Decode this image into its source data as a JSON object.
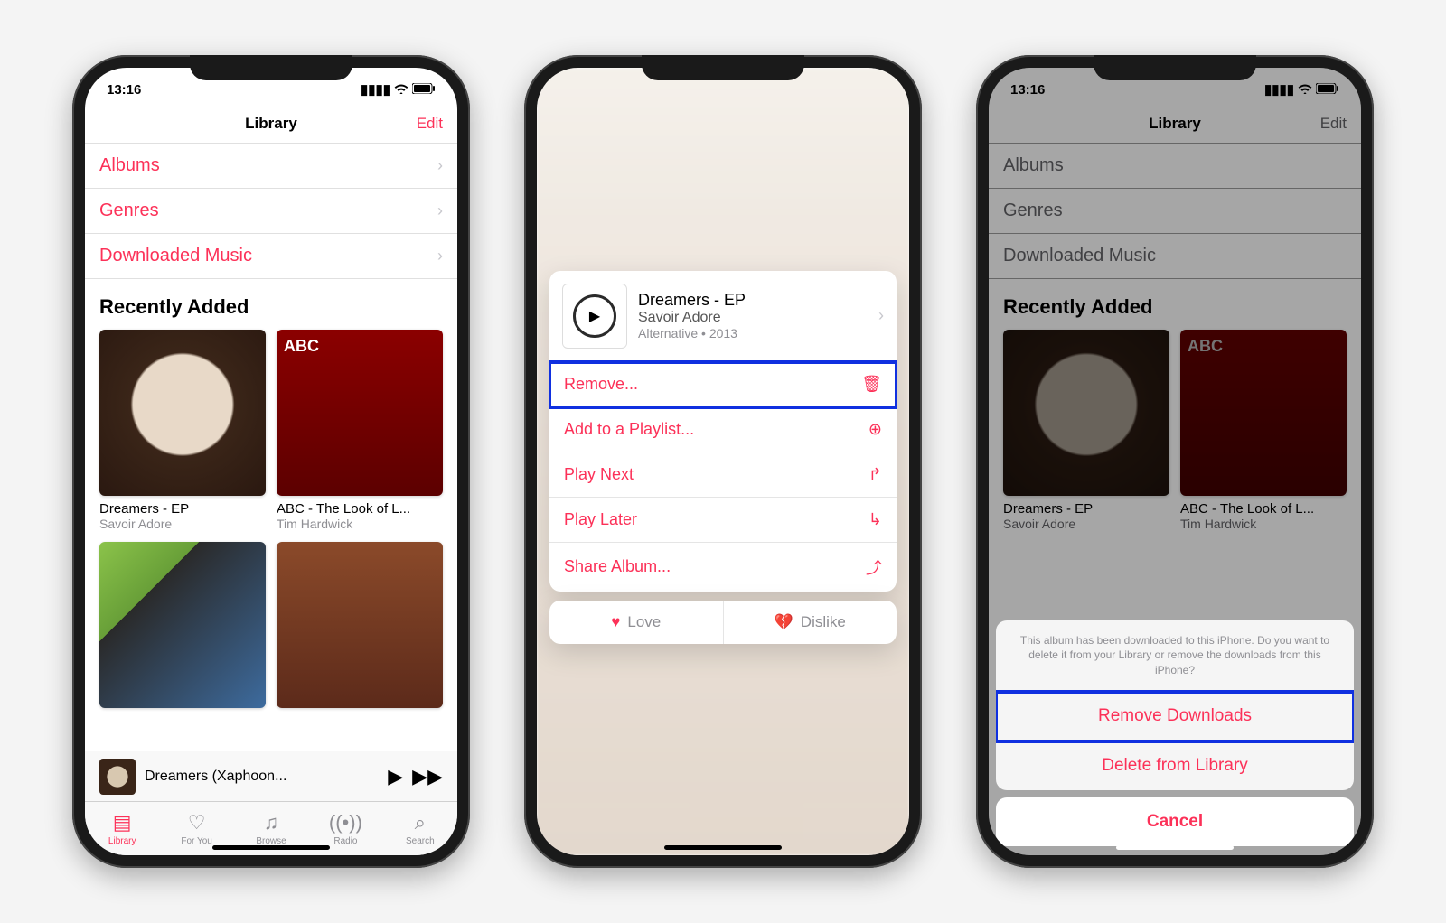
{
  "status": {
    "time": "13:16"
  },
  "nav": {
    "title": "Library",
    "edit": "Edit"
  },
  "library": {
    "items": [
      {
        "label": "Albums"
      },
      {
        "label": "Genres"
      },
      {
        "label": "Downloaded Music"
      }
    ],
    "section": "Recently Added",
    "albums": [
      {
        "title": "Dreamers - EP",
        "artist": "Savoir Adore"
      },
      {
        "title": "ABC - The Look of L...",
        "artist": "Tim Hardwick"
      }
    ]
  },
  "nowPlaying": {
    "title": "Dreamers (Xaphoon..."
  },
  "tabs": [
    {
      "label": "Library"
    },
    {
      "label": "For You"
    },
    {
      "label": "Browse"
    },
    {
      "label": "Radio"
    },
    {
      "label": "Search"
    }
  ],
  "contextMenu": {
    "title": "Dreamers - EP",
    "artist": "Savoir Adore",
    "meta": "Alternative • 2013",
    "items": [
      {
        "label": "Remove..."
      },
      {
        "label": "Add to a Playlist..."
      },
      {
        "label": "Play Next"
      },
      {
        "label": "Play Later"
      },
      {
        "label": "Share Album..."
      }
    ],
    "love": "Love",
    "dislike": "Dislike"
  },
  "actionSheet": {
    "message": "This album has been downloaded to this iPhone. Do you want to delete it from your Library or remove the downloads from this iPhone?",
    "removeDownloads": "Remove Downloads",
    "deleteFromLibrary": "Delete from Library",
    "cancel": "Cancel"
  }
}
